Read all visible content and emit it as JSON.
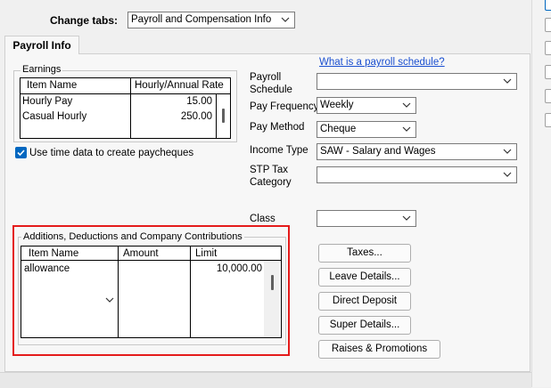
{
  "header": {
    "change_tabs_label": "Change tabs:",
    "change_tabs_value": "Payroll and Compensation Info"
  },
  "tab": {
    "label": "Payroll Info"
  },
  "earnings": {
    "group_label": "Earnings",
    "columns": [
      "Item Name",
      "Hourly/Annual Rate"
    ],
    "rows": [
      {
        "name": "Hourly Pay",
        "rate": "15.00"
      },
      {
        "name": "Casual Hourly",
        "rate": "250.00"
      }
    ]
  },
  "use_time_data": {
    "label": "Use time data to create paycheques",
    "checked": true
  },
  "payroll": {
    "schedule_link": "What is a payroll schedule?",
    "schedule_label": "Payroll Schedule",
    "schedule_value": "",
    "frequency_label": "Pay Frequency",
    "frequency_value": "Weekly",
    "method_label": "Pay Method",
    "method_value": "Cheque",
    "income_type_label": "Income Type",
    "income_type_value": "SAW - Salary and Wages",
    "stp_label": "STP Tax Category",
    "stp_value": "",
    "class_label": "Class",
    "class_value": ""
  },
  "additions": {
    "group_label": "Additions, Deductions and Company Contributions",
    "columns": [
      "Item Name",
      "Amount",
      "Limit"
    ],
    "rows": [
      {
        "name": "allowance",
        "amount": "",
        "limit": "10,000.00"
      }
    ]
  },
  "buttons": {
    "taxes": "Taxes...",
    "leave_details": "Leave Details...",
    "direct_deposit": "Direct Deposit",
    "super_details": "Super Details...",
    "raises_promotions": "Raises & Promotions"
  },
  "colors": {
    "highlight": "#e41b1b",
    "link": "#1a4fd0",
    "checkbox": "#0067c0"
  }
}
